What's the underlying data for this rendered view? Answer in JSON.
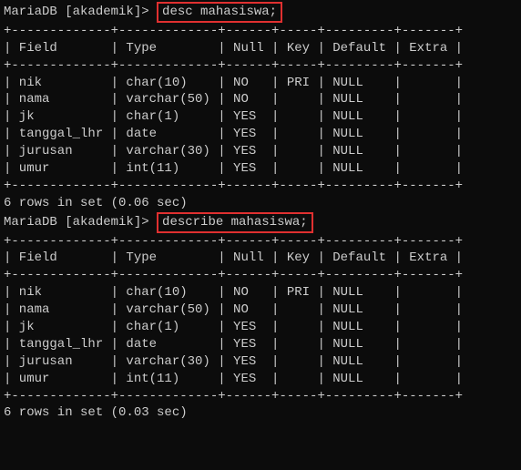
{
  "block1": {
    "prompt": "MariaDB [akademik]>",
    "command": "desc mahasiswa;",
    "sep": "+-------------+-------------+------+-----+---------+-------+",
    "header": "| Field       | Type        | Null | Key | Default | Extra |",
    "rows": [
      "| nik         | char(10)    | NO   | PRI | NULL    |       |",
      "| nama        | varchar(50) | NO   |     | NULL    |       |",
      "| jk          | char(1)     | YES  |     | NULL    |       |",
      "| tanggal_lhr | date        | YES  |     | NULL    |       |",
      "| jurusan     | varchar(30) | YES  |     | NULL    |       |",
      "| umur        | int(11)     | YES  |     | NULL    |       |"
    ],
    "footer": "6 rows in set (0.06 sec)"
  },
  "block2": {
    "prompt": "MariaDB [akademik]>",
    "command": "describe mahasiswa;",
    "sep": "+-------------+-------------+------+-----+---------+-------+",
    "header": "| Field       | Type        | Null | Key | Default | Extra |",
    "rows": [
      "| nik         | char(10)    | NO   | PRI | NULL    |       |",
      "| nama        | varchar(50) | NO   |     | NULL    |       |",
      "| jk          | char(1)     | YES  |     | NULL    |       |",
      "| tanggal_lhr | date        | YES  |     | NULL    |       |",
      "| jurusan     | varchar(30) | YES  |     | NULL    |       |",
      "| umur        | int(11)     | YES  |     | NULL    |       |"
    ],
    "footer": "6 rows in set (0.03 sec)"
  },
  "blank": ""
}
